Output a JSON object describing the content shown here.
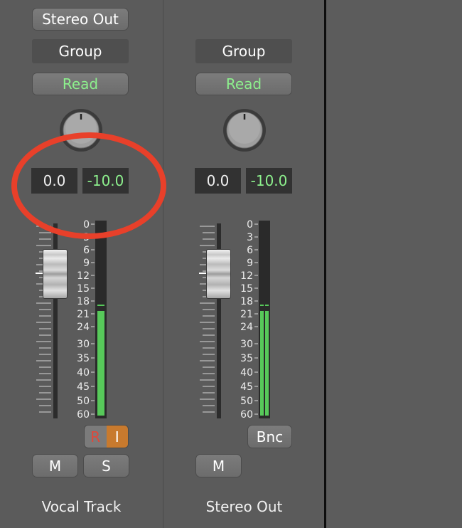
{
  "colors": {
    "accent_green": "#8df08d",
    "meter_green": "#57c95a",
    "record_red": "#e0483a",
    "input_orange": "#c87a2e",
    "highlight_red": "#e8402a"
  },
  "strips": [
    {
      "output": "Stereo Out",
      "group": "Group",
      "automation": "Read",
      "pan_value": "0.0",
      "peak_value": "-10.0",
      "record_label": "R",
      "input_label": "I",
      "mute": "M",
      "solo": "S",
      "name": "Vocal Track",
      "meter_level_db": -21
    },
    {
      "group": "Group",
      "automation": "Read",
      "pan_value": "0.0",
      "peak_value": "-10.0",
      "bounce": "Bnc",
      "mute": "M",
      "name": "Stereo Out",
      "meter_level_db": -21
    }
  ],
  "meter_scale": [
    "0",
    "3",
    "6",
    "9",
    "12",
    "15",
    "18",
    "21",
    "24",
    "30",
    "35",
    "40",
    "45",
    "50",
    "60"
  ]
}
